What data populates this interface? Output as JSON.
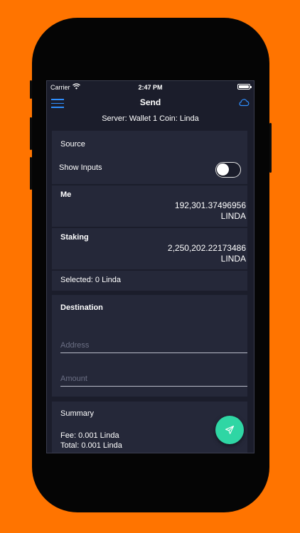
{
  "status_bar": {
    "carrier": "Carrier",
    "time": "2:47 PM",
    "battery_level": 1.0
  },
  "nav": {
    "title": "Send",
    "menu_icon": "hamburger-icon",
    "right_icon": "cloud-icon"
  },
  "server_info": "Server: Wallet 1 Coin: Linda",
  "source": {
    "title": "Source",
    "show_inputs_label": "Show Inputs",
    "show_inputs_on": false,
    "accounts": [
      {
        "name": "Me",
        "amount": "192,301.37496956",
        "unit": "LINDA"
      },
      {
        "name": "Staking",
        "amount": "2,250,202.22173486",
        "unit": "LINDA"
      }
    ],
    "selected": "Selected: 0 Linda"
  },
  "destination": {
    "title": "Destination",
    "address_placeholder": "Address",
    "amount_placeholder": "Amount"
  },
  "summary": {
    "title": "Summary",
    "fee": "Fee: 0.001 Linda",
    "total": "Total: 0.001 Linda"
  },
  "send_button_icon": "send-icon",
  "colors": {
    "background": "#ff7400",
    "screen": "#1b1d2b",
    "card": "#252839",
    "accent": "#2f8fff",
    "fab": "#2fd6a4"
  }
}
